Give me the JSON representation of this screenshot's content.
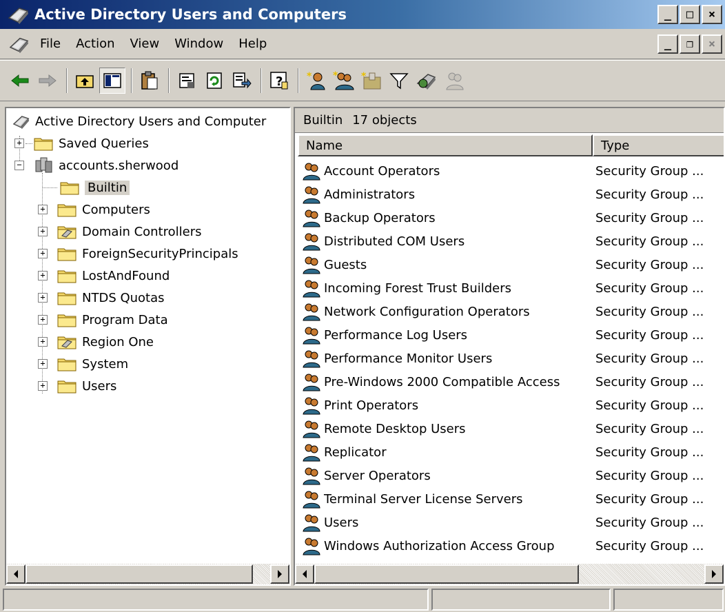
{
  "window": {
    "title": "Active Directory Users and Computers",
    "minimize_label": "_",
    "maximize_label": "□",
    "close_label": "×"
  },
  "menu": {
    "items": [
      "File",
      "Action",
      "View",
      "Window",
      "Help"
    ],
    "restore_label": "❐"
  },
  "toolbar": {
    "icons": [
      "back-arrow-icon",
      "forward-arrow-icon",
      "up-folder-icon",
      "show-hide-console-tree-icon",
      "paste-icon",
      "properties-icon",
      "refresh-icon",
      "export-list-icon",
      "help-icon",
      "create-user-icon",
      "create-group-icon",
      "create-ou-icon",
      "filter-icon",
      "find-icon",
      "add-to-group-icon"
    ]
  },
  "tree": {
    "root_label": "Active Directory Users and Computer",
    "saved_queries": "Saved Queries",
    "domain": "accounts.sherwood",
    "children": [
      "Builtin",
      "Computers",
      "Domain Controllers",
      "ForeignSecurityPrincipals",
      "LostAndFound",
      "NTDS Quotas",
      "Program Data",
      "Region One",
      "System",
      "Users"
    ],
    "selected": "Builtin"
  },
  "list": {
    "container_name": "Builtin",
    "object_count": "17 objects",
    "columns": [
      "Name",
      "Type"
    ],
    "rows": [
      {
        "name": "Account Operators",
        "type": "Security Group ..."
      },
      {
        "name": "Administrators",
        "type": "Security Group ..."
      },
      {
        "name": "Backup Operators",
        "type": "Security Group ..."
      },
      {
        "name": "Distributed COM Users",
        "type": "Security Group ..."
      },
      {
        "name": "Guests",
        "type": "Security Group ..."
      },
      {
        "name": "Incoming Forest Trust Builders",
        "type": "Security Group ..."
      },
      {
        "name": "Network Configuration Operators",
        "type": "Security Group ..."
      },
      {
        "name": "Performance Log Users",
        "type": "Security Group ..."
      },
      {
        "name": "Performance Monitor Users",
        "type": "Security Group ..."
      },
      {
        "name": "Pre-Windows 2000 Compatible Access",
        "type": "Security Group ..."
      },
      {
        "name": "Print Operators",
        "type": "Security Group ..."
      },
      {
        "name": "Remote Desktop Users",
        "type": "Security Group ..."
      },
      {
        "name": "Replicator",
        "type": "Security Group ..."
      },
      {
        "name": "Server Operators",
        "type": "Security Group ..."
      },
      {
        "name": "Terminal Server License Servers",
        "type": "Security Group ..."
      },
      {
        "name": "Users",
        "type": "Security Group ..."
      },
      {
        "name": "Windows Authorization Access Group",
        "type": "Security Group ..."
      }
    ]
  },
  "colors": {
    "title_gradient_start": "#0a246a",
    "title_gradient_end": "#a6caf0",
    "face": "#d4d0c8"
  }
}
